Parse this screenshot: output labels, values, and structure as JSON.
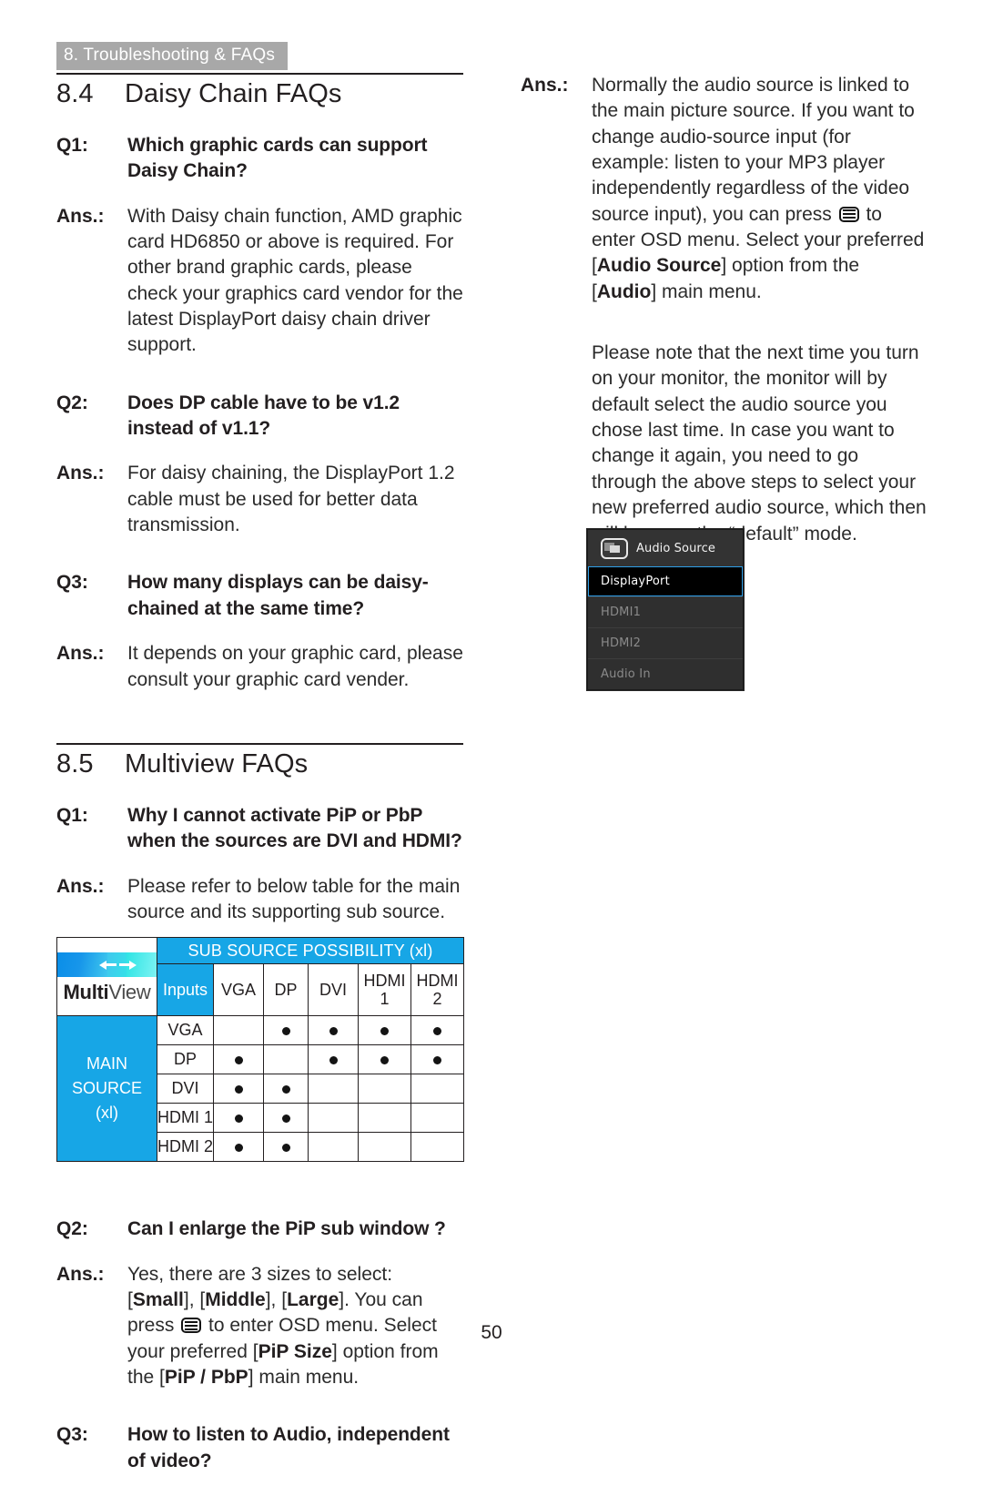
{
  "header": {
    "running_head": "8. Troubleshooting & FAQs"
  },
  "page_number": "50",
  "left_column": {
    "section_84": {
      "number": "8.4",
      "title": "Daisy Chain FAQs",
      "items": [
        {
          "label": "Q1:",
          "text": "Which graphic cards can support Daisy Chain?",
          "kind": "question"
        },
        {
          "label": "Ans.:",
          "text": "With Daisy chain function, AMD graphic card HD6850 or above is required. For other brand graphic cards, please check your graphics card vendor for the latest DisplayPort daisy chain driver support.",
          "kind": "answer"
        },
        {
          "label": "Q2:",
          "text": "Does DP cable have to be v1.2 instead of v1.1?",
          "kind": "question"
        },
        {
          "label": "Ans.:",
          "text": "For daisy chaining, the DisplayPort 1.2 cable must be used for better data transmission.",
          "kind": "answer"
        },
        {
          "label": "Q3:",
          "text": "How many displays can be daisy-chained at the same time?",
          "kind": "question"
        },
        {
          "label": "Ans.:",
          "text": "It depends on your graphic card, please consult your graphic card vender.",
          "kind": "answer"
        }
      ]
    },
    "section_85": {
      "number": "8.5",
      "title": "Multiview FAQs",
      "q1_label": "Q1:",
      "q1_text": "Why I cannot activate PiP or PbP when the sources are DVI and HDMI?",
      "a1_label": "Ans.:",
      "a1_text": "Please refer to below table for the main source and its supporting sub source.",
      "q2_label": "Q2:",
      "q2_text": "Can I enlarge the PiP sub window ?",
      "a2_label": "Ans.:",
      "a2_part1": "Yes, there are 3 sizes to select: [",
      "a2_small": "Small",
      "a2_part2": "], [",
      "a2_middle": "Middle",
      "a2_part3": "], [",
      "a2_large": "Large",
      "a2_part4": "]. You can press ",
      "a2_part5": " to enter OSD menu. Select your preferred [",
      "a2_pipsize": "PiP Size",
      "a2_part6": "] option from the [",
      "a2_pippbp": "PiP / PbP",
      "a2_part7": "] main menu.",
      "q3_label": "Q3:",
      "q3_text": "How to listen to Audio, independent of video?"
    }
  },
  "multiview_table": {
    "logo_bold": "Multi",
    "logo_light": "View",
    "sub_source_header": "SUB SOURCE POSSIBILITY (xl)",
    "inputs_label": "Inputs",
    "main_source_line1": "MAIN",
    "main_source_line2": "SOURCE",
    "main_source_line3": "(xl)",
    "columns": [
      "VGA",
      "DP",
      "DVI",
      "HDMI 1",
      "HDMI 2"
    ],
    "column_labels": [
      {
        "line1": "VGA",
        "line2": ""
      },
      {
        "line1": "DP",
        "line2": ""
      },
      {
        "line1": "DVI",
        "line2": ""
      },
      {
        "line1": "HDMI",
        "line2": "1"
      },
      {
        "line1": "HDMI",
        "line2": "2"
      }
    ],
    "rows": [
      {
        "label": "VGA",
        "cells": [
          false,
          true,
          true,
          true,
          true
        ]
      },
      {
        "label": "DP",
        "cells": [
          true,
          false,
          true,
          true,
          true
        ]
      },
      {
        "label": "DVI",
        "cells": [
          true,
          true,
          false,
          false,
          false
        ]
      },
      {
        "label": "HDMI 1",
        "cells": [
          true,
          true,
          false,
          false,
          false
        ]
      },
      {
        "label": "HDMI 2",
        "cells": [
          true,
          true,
          false,
          false,
          false
        ]
      }
    ],
    "accent_color": "#17a6e6"
  },
  "right_column": {
    "answer": {
      "label": "Ans.:",
      "part1": "Normally the audio source is linked to the main picture source. If you want to change audio-source input (for example: listen to your MP3 player independently regardless of the video source input), you can press ",
      "part2": " to enter OSD menu. Select your preferred  [",
      "bold_audio_source": "Audio Source",
      "part3": "] option from the [",
      "bold_audio": "Audio",
      "part4": "] main menu."
    },
    "note": "Please note that the next time you turn on your monitor, the monitor will by default select the audio source you chose last time. In case you want to change it again, you need to go through the above steps to select your new preferred audio source, which then will become the “default” mode."
  },
  "osd_menu": {
    "title": "Audio Source",
    "items": [
      {
        "label": "DisplayPort",
        "selected": true
      },
      {
        "label": "HDMI1",
        "selected": false
      },
      {
        "label": "HDMI2",
        "selected": false
      },
      {
        "label": "Audio In",
        "selected": false
      }
    ],
    "selection_border_color": "#2f9fe8"
  }
}
